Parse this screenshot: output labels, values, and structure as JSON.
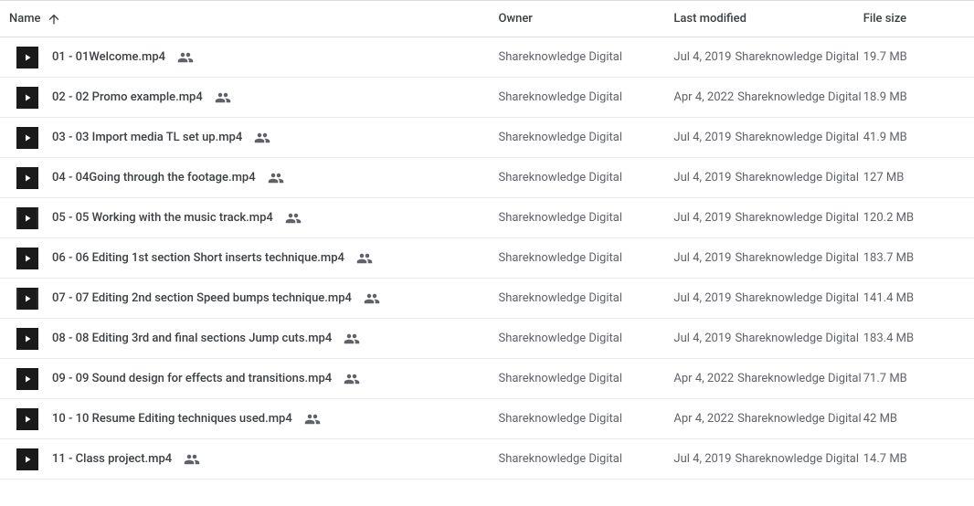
{
  "headers": {
    "name": "Name",
    "owner": "Owner",
    "last_modified": "Last modified",
    "file_size": "File size"
  },
  "files": [
    {
      "name": "01 - 01Welcome.mp4",
      "icon_variant": "plain",
      "owner": "Shareknowledge Digital",
      "modified_date": "Jul 4, 2019",
      "modified_by": "Shareknowledge Digital",
      "size": "19.7 MB"
    },
    {
      "name": "02 - 02 Promo example.mp4",
      "icon_variant": "plain",
      "owner": "Shareknowledge Digital",
      "modified_date": "Apr 4, 2022",
      "modified_by": "Shareknowledge Digital",
      "size": "18.9 MB"
    },
    {
      "name": "03 - 03 Import media TL set up.mp4",
      "icon_variant": "plain",
      "owner": "Shareknowledge Digital",
      "modified_date": "Jul 4, 2019",
      "modified_by": "Shareknowledge Digital",
      "size": "41.9 MB"
    },
    {
      "name": "04 - 04Going through the footage.mp4",
      "icon_variant": "plain",
      "owner": "Shareknowledge Digital",
      "modified_date": "Jul 4, 2019",
      "modified_by": "Shareknowledge Digital",
      "size": "127 MB"
    },
    {
      "name": "05 - 05 Working with the music track.mp4",
      "icon_variant": "strip",
      "owner": "Shareknowledge Digital",
      "modified_date": "Jul 4, 2019",
      "modified_by": "Shareknowledge Digital",
      "size": "120.2 MB"
    },
    {
      "name": "06 - 06 Editing 1st section Short inserts technique.mp4",
      "icon_variant": "plain",
      "owner": "Shareknowledge Digital",
      "modified_date": "Jul 4, 2019",
      "modified_by": "Shareknowledge Digital",
      "size": "183.7 MB"
    },
    {
      "name": "07 - 07 Editing 2nd section Speed bumps technique.mp4",
      "icon_variant": "strip",
      "owner": "Shareknowledge Digital",
      "modified_date": "Jul 4, 2019",
      "modified_by": "Shareknowledge Digital",
      "size": "141.4 MB"
    },
    {
      "name": "08 - 08 Editing 3rd and final sections Jump cuts.mp4",
      "icon_variant": "plain",
      "owner": "Shareknowledge Digital",
      "modified_date": "Jul 4, 2019",
      "modified_by": "Shareknowledge Digital",
      "size": "183.4 MB"
    },
    {
      "name": "09 - 09 Sound design for effects and transitions.mp4",
      "icon_variant": "plain",
      "owner": "Shareknowledge Digital",
      "modified_date": "Apr 4, 2022",
      "modified_by": "Shareknowledge Digital",
      "size": "71.7 MB"
    },
    {
      "name": "10 - 10 Resume Editing techniques used.mp4",
      "icon_variant": "plain",
      "owner": "Shareknowledge Digital",
      "modified_date": "Apr 4, 2022",
      "modified_by": "Shareknowledge Digital",
      "size": "42 MB"
    },
    {
      "name": "11 - Class project.mp4",
      "icon_variant": "plain",
      "owner": "Shareknowledge Digital",
      "modified_date": "Jul 4, 2019",
      "modified_by": "Shareknowledge Digital",
      "size": "14.7 MB"
    }
  ]
}
